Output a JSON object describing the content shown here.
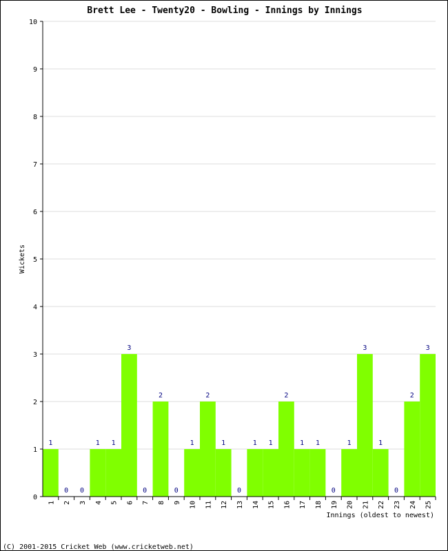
{
  "chart_data": {
    "type": "bar",
    "title": "Brett Lee - Twenty20 - Bowling - Innings by Innings",
    "xlabel": "Innings (oldest to newest)",
    "ylabel": "Wickets",
    "ylim": [
      0,
      10
    ],
    "yticks": [
      0,
      1,
      2,
      3,
      4,
      5,
      6,
      7,
      8,
      9,
      10
    ],
    "grid": true,
    "categories": [
      "1",
      "2",
      "3",
      "4",
      "5",
      "6",
      "7",
      "8",
      "9",
      "10",
      "11",
      "12",
      "13",
      "14",
      "15",
      "16",
      "17",
      "18",
      "19",
      "20",
      "21",
      "22",
      "23",
      "24",
      "25"
    ],
    "values": [
      1,
      0,
      0,
      1,
      1,
      3,
      0,
      2,
      0,
      1,
      2,
      1,
      0,
      1,
      1,
      2,
      1,
      1,
      0,
      1,
      3,
      1,
      0,
      2,
      3
    ],
    "bar_color": "#80ff00",
    "label_color": "#000080",
    "grid_color": "#dddddd"
  },
  "footer": "(C) 2001-2015 Cricket Web (www.cricketweb.net)"
}
